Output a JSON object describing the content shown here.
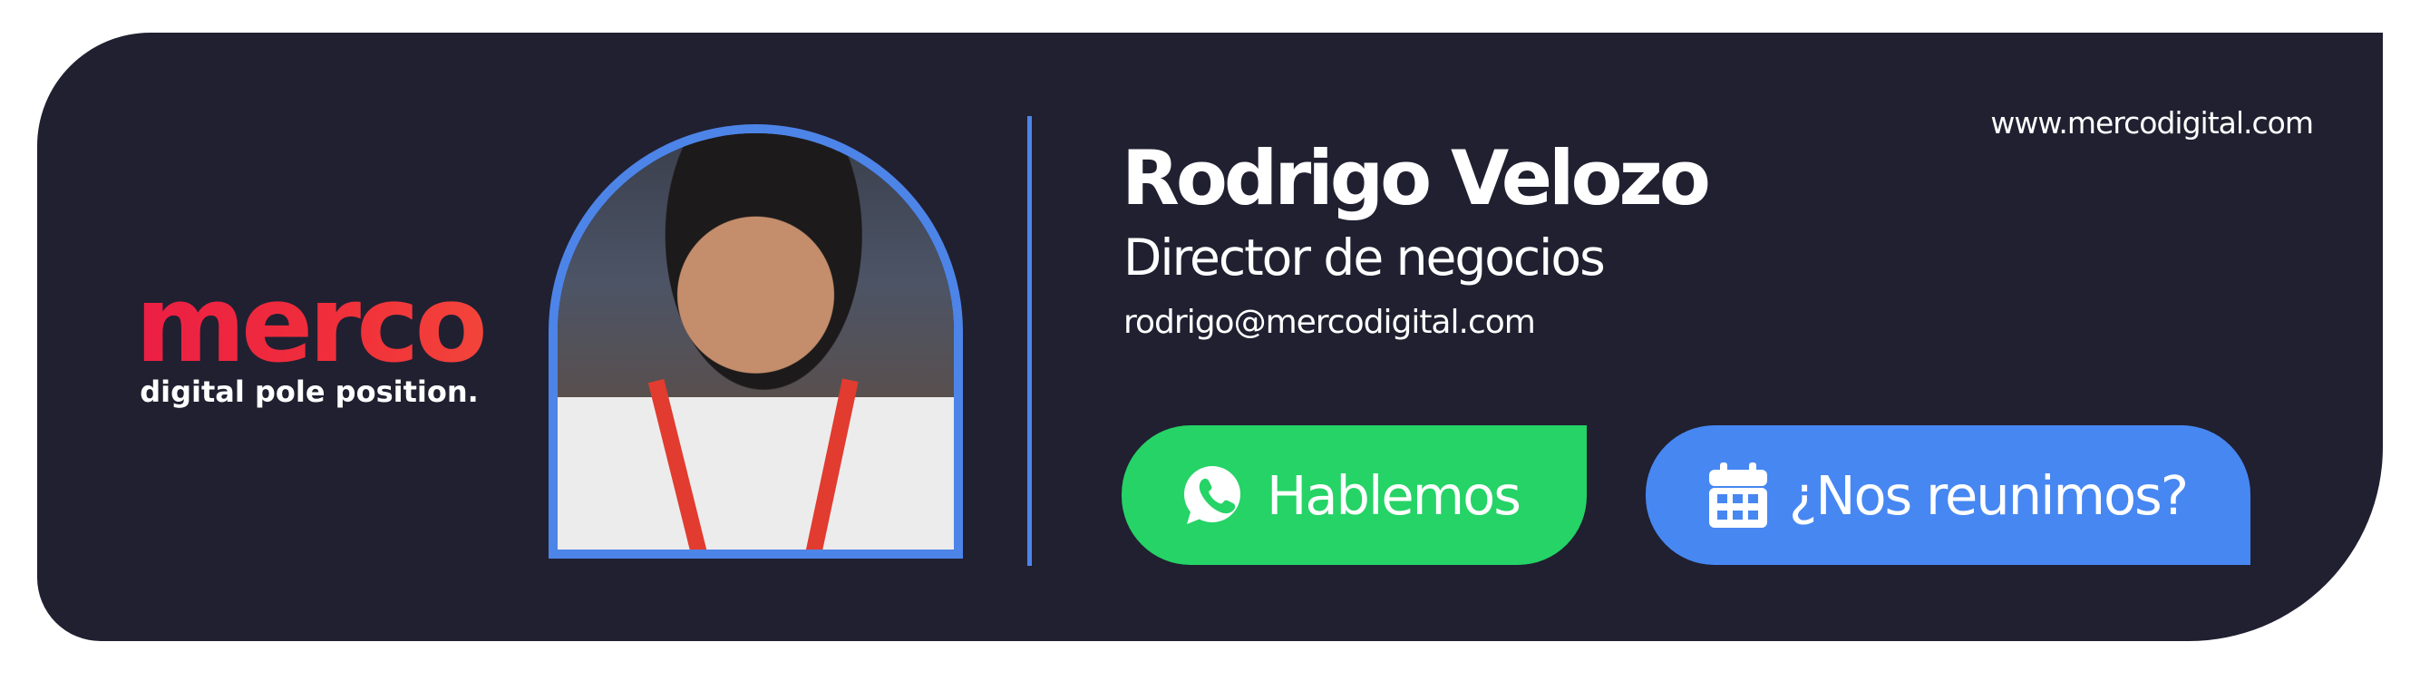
{
  "brand": {
    "logo_text": "merco",
    "tagline": "digital pole position."
  },
  "profile": {
    "name": "Rodrigo Velozo",
    "role": "Director de negocios",
    "email": "rodrigo@mercodigital.com",
    "website": "www.mercodigital.com",
    "photo_alt": "Rodrigo Velozo"
  },
  "buttons": {
    "whatsapp": {
      "label": "Hablemos",
      "icon": "whatsapp-icon",
      "color": "#25d366"
    },
    "meeting": {
      "label": "¿Nos reunimos?",
      "icon": "calendar-icon",
      "color": "#4787f2"
    }
  },
  "colors": {
    "card_background": "#202031",
    "accent_blue": "#4d84e8",
    "brand_red": "#ec2d46"
  }
}
